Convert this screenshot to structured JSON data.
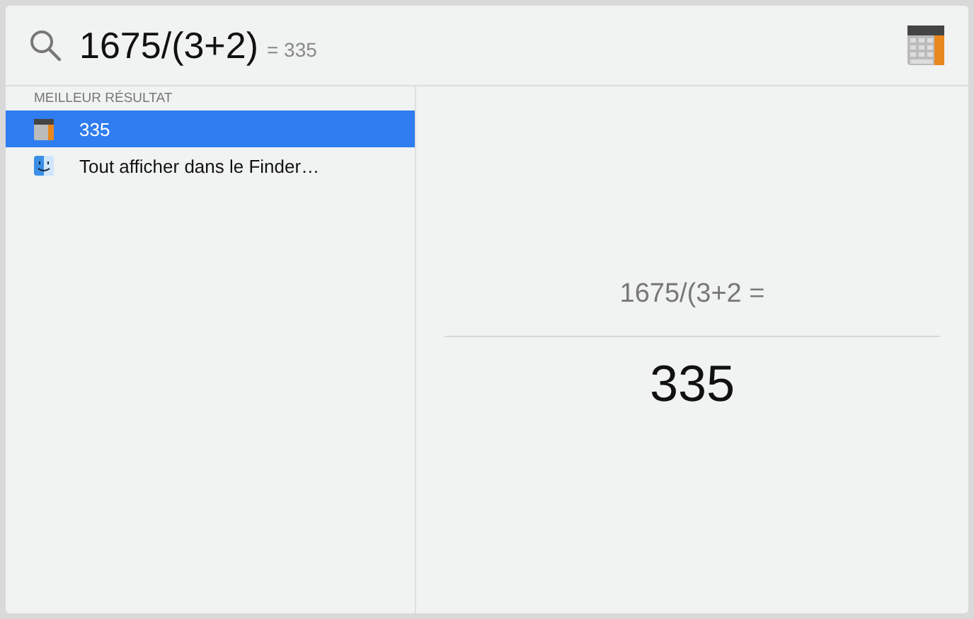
{
  "search": {
    "query": "1675/(3+2)",
    "inline_result": "= 335"
  },
  "results": {
    "section": "MEILLEUR RÉSULTAT",
    "items": [
      {
        "kind": "calculator",
        "label": "335",
        "selected": true
      },
      {
        "kind": "finder",
        "label": "Tout afficher dans le Finder…",
        "selected": false
      }
    ]
  },
  "preview": {
    "expression": "1675/(3+2 =",
    "result": "335"
  }
}
